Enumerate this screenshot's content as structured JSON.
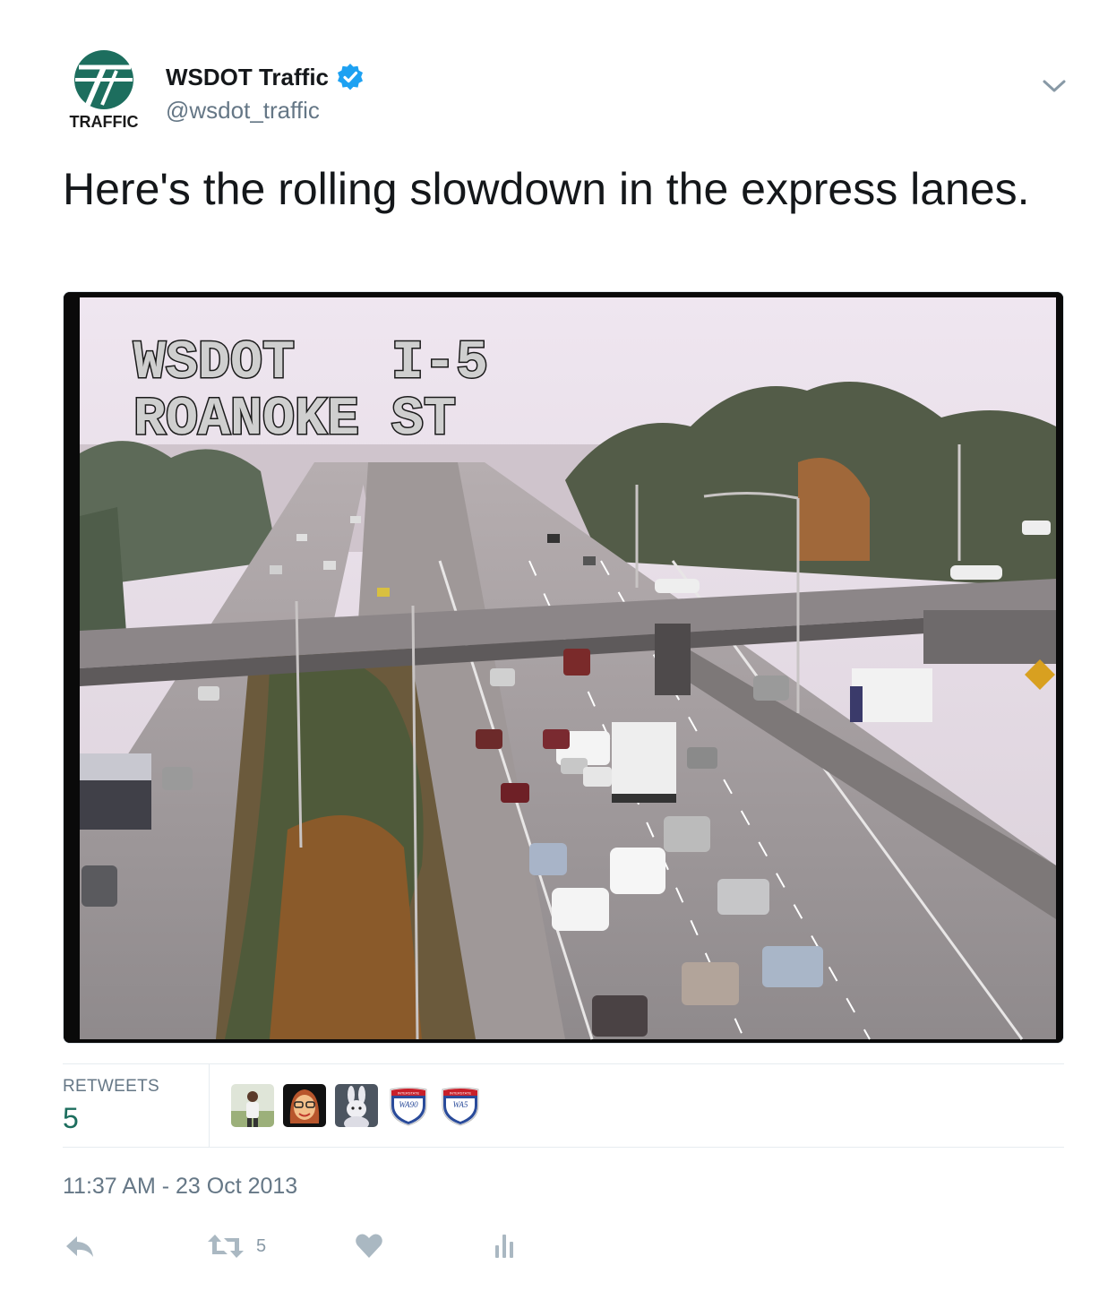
{
  "header": {
    "avatar_text": "TRAFFIC",
    "display_name": "WSDOT Traffic",
    "handle": "@wsdot_traffic"
  },
  "tweet": {
    "text": "Here's the rolling slowdown in the express lanes."
  },
  "photo": {
    "overlay_line1": "WSDOT   I-5",
    "overlay_line2": "ROANOKE ST"
  },
  "stats": {
    "retweets_label": "RETWEETS",
    "retweets_count": "5",
    "retweeters": [
      {
        "name": "person-photo"
      },
      {
        "name": "cartoon-avatar"
      },
      {
        "name": "bunny-avatar"
      },
      {
        "name": "interstate-shield-wa90",
        "shield_top": "INTERSTATE",
        "shield_label": "WA90"
      },
      {
        "name": "interstate-shield-wa5",
        "shield_top": "INTERSTATE",
        "shield_label": "WA5"
      }
    ]
  },
  "timestamp": "11:37 AM - 23 Oct 2013",
  "actions": {
    "retweet_count": "5"
  },
  "colors": {
    "brand_green": "#1d6e5e",
    "verified_blue": "#1da1f2",
    "muted": "#657786",
    "icon_gray": "#aab8c2"
  }
}
